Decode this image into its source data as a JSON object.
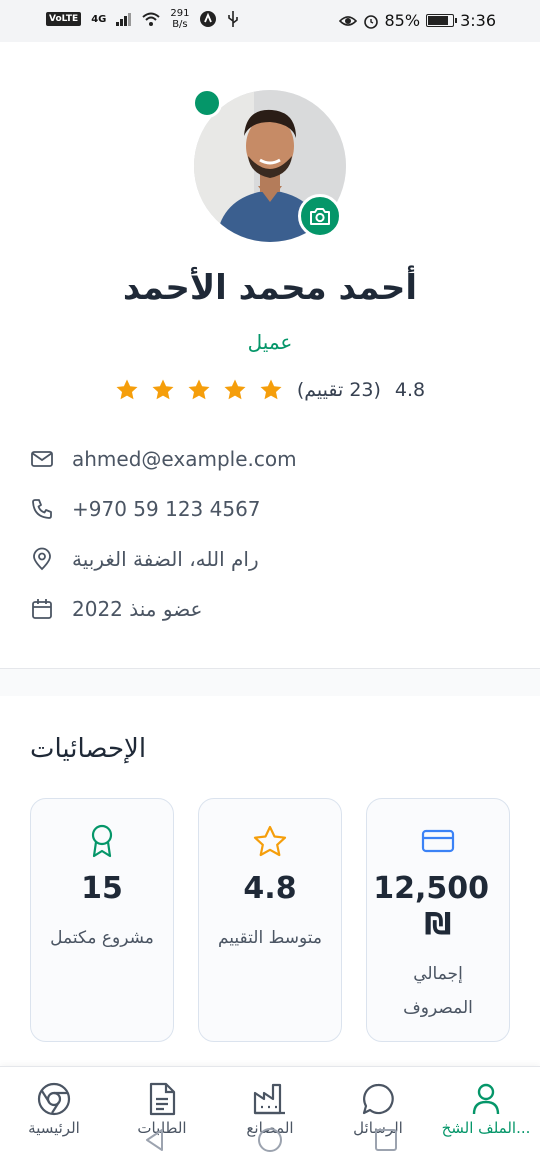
{
  "status_bar": {
    "network": "VoLTE",
    "signal": "4G",
    "speed_value": "291",
    "speed_unit": "B/s",
    "battery": "85%",
    "battery_level": 0.85,
    "time": "3:36"
  },
  "profile": {
    "name": "أحمد محمد الأحمد",
    "role": "عميل",
    "rating": "4.8",
    "reviews": "(23 تقييم)",
    "stars": 5,
    "online": true
  },
  "info": {
    "email": "ahmed@example.com",
    "phone": "+970 59 123 4567",
    "location": "رام الله، الضفة الغربية",
    "member_since": "عضو منذ 2022"
  },
  "stats": {
    "title": "الإحصائيات",
    "cards": [
      {
        "value": "15",
        "label": "مشروع مكتمل",
        "icon": "award-icon"
      },
      {
        "value": "4.8",
        "label": "متوسط التقييم",
        "icon": "star-icon"
      },
      {
        "value": "12,500 ₪",
        "label": "إجمالي المصروف",
        "icon": "credit-card-icon"
      }
    ]
  },
  "nav": {
    "home": "الرئيسية",
    "orders": "الطلبات",
    "factories": "المصانع",
    "messages": "الرسائل",
    "profile": "الملف الشخ..."
  },
  "colors": {
    "accent": "#059669",
    "star": "#f59e0b",
    "text": "#1f2937",
    "card_icon_blue": "#3b82f6"
  }
}
